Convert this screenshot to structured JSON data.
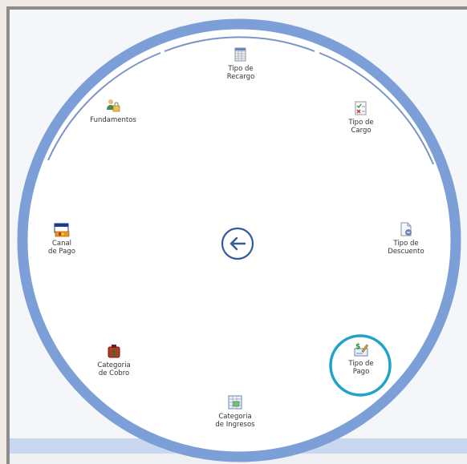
{
  "menu": {
    "back_icon": "arrow-left-icon",
    "items": [
      {
        "id": "tipo-recargo",
        "label": "Tipo de\nRecargo",
        "icon": "spreadsheet-icon"
      },
      {
        "id": "tipo-cargo",
        "label": "Tipo de\nCargo",
        "icon": "checklist-icon"
      },
      {
        "id": "tipo-descuento",
        "label": "Tipo de\nDescuento",
        "icon": "document-discount-icon"
      },
      {
        "id": "tipo-pago",
        "label": "Tipo de\nPago",
        "icon": "check-payment-icon"
      },
      {
        "id": "categoria-ingresos",
        "label": "Categoria\nde Ingresos",
        "icon": "table-money-icon"
      },
      {
        "id": "categoria-cobro",
        "label": "Categoria\nde Cobro",
        "icon": "money-bag-icon"
      },
      {
        "id": "canal-pago",
        "label": "Canal\nde Pago",
        "icon": "credit-card-icon"
      },
      {
        "id": "fundamentos",
        "label": "Fundamentos",
        "icon": "users-lock-icon"
      }
    ],
    "highlighted_item": "tipo-pago"
  },
  "colors": {
    "ring": "#7b9fd6",
    "ring_inner": "#ffffff",
    "highlight": "#1fa3c9",
    "back_button": "#2f5d9e"
  }
}
